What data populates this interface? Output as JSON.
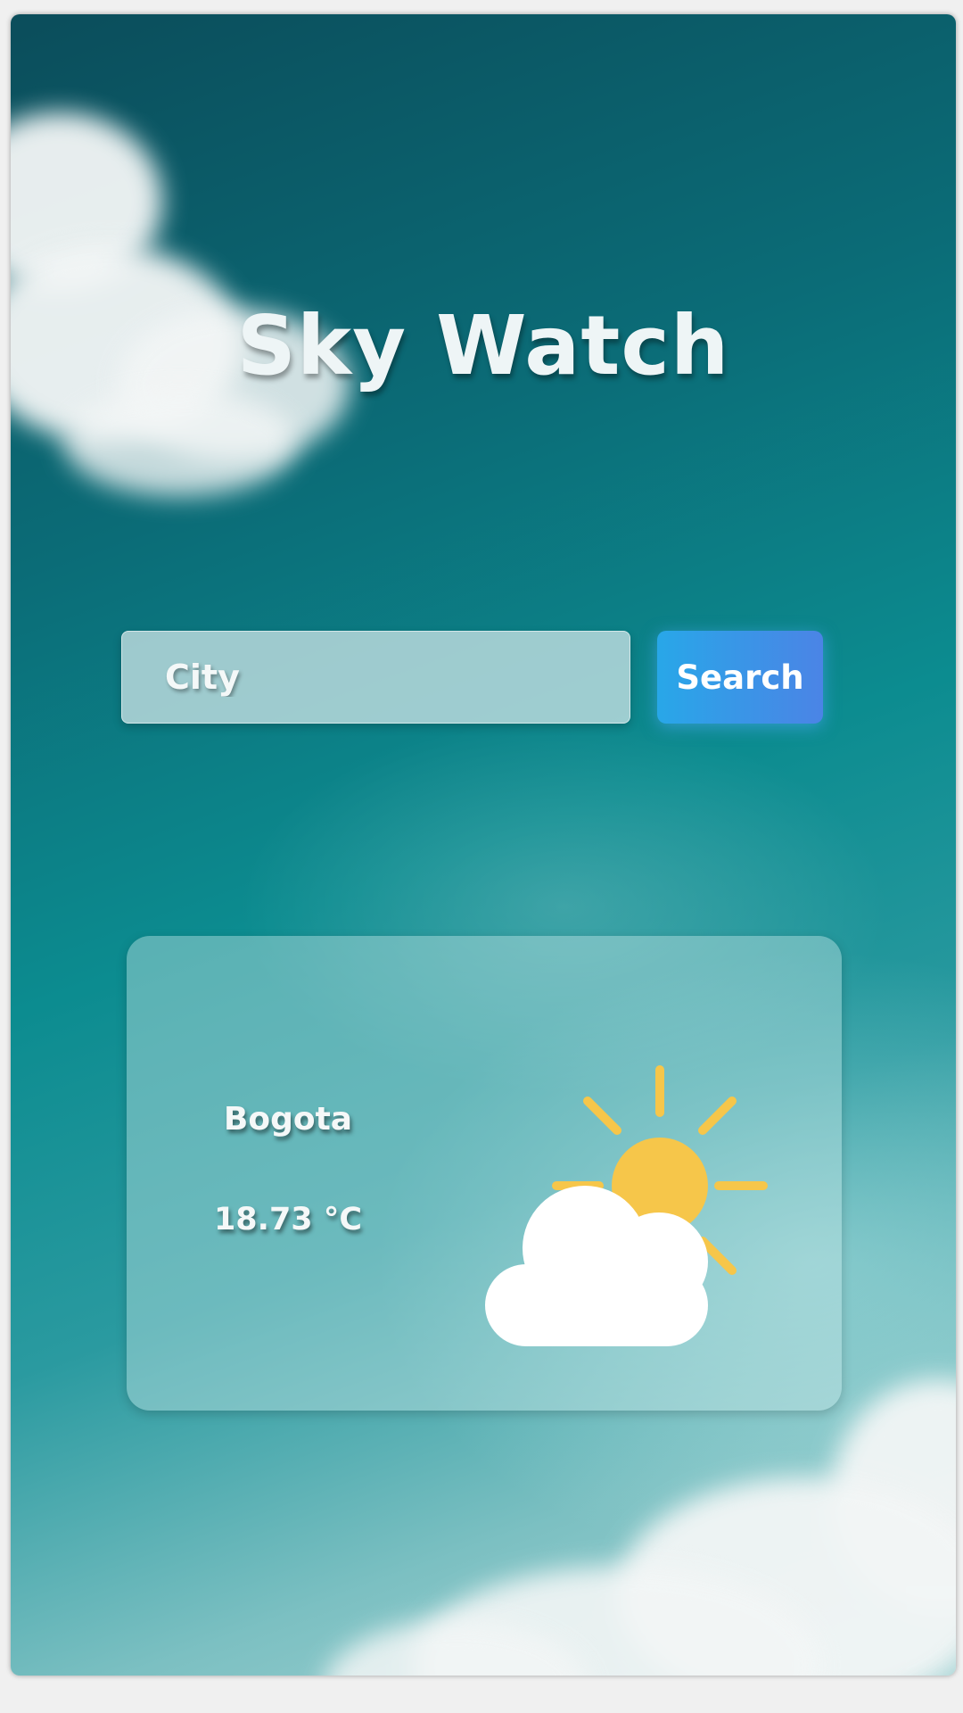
{
  "app": {
    "title": "Sky Watch"
  },
  "search": {
    "placeholder": "City",
    "button_label": "Search"
  },
  "weather": {
    "city": "Bogota",
    "temperature": "18.73 °C",
    "condition_icon": "partly-cloudy-icon"
  },
  "colors": {
    "button_gradient_start": "#28a7e8",
    "button_gradient_end": "#4b84e6",
    "sun": "#f6c64a",
    "cloud": "#ffffff"
  }
}
